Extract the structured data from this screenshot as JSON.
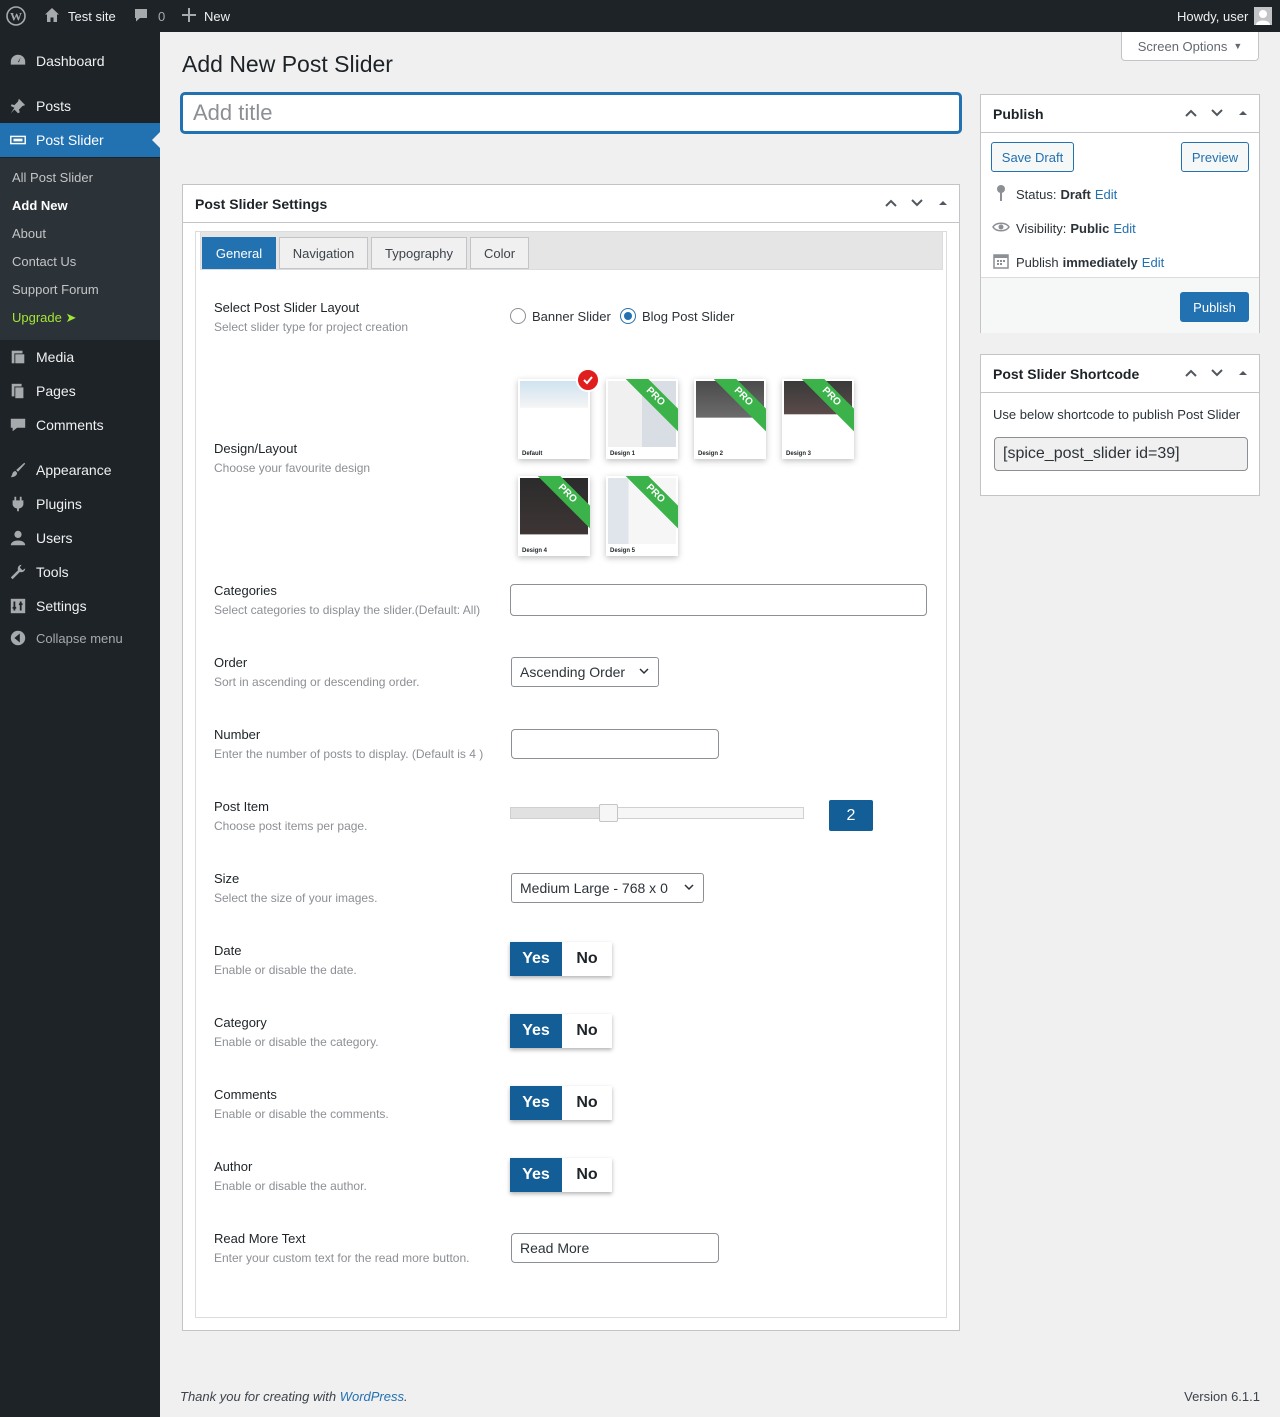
{
  "adminbar": {
    "site_name": "Test site",
    "comments_count": "0",
    "new_label": "New",
    "howdy": "Howdy, user"
  },
  "sidebar": {
    "items": [
      {
        "label": "Dashboard",
        "icon": "dashboard-icon"
      },
      {
        "label": "Posts",
        "icon": "pin-icon"
      },
      {
        "label": "Post Slider",
        "icon": "slider-icon"
      },
      {
        "label": "Media",
        "icon": "media-icon"
      },
      {
        "label": "Pages",
        "icon": "pages-icon"
      },
      {
        "label": "Comments",
        "icon": "comments-icon"
      },
      {
        "label": "Appearance",
        "icon": "brush-icon"
      },
      {
        "label": "Plugins",
        "icon": "plugin-icon"
      },
      {
        "label": "Users",
        "icon": "user-icon"
      },
      {
        "label": "Tools",
        "icon": "wrench-icon"
      },
      {
        "label": "Settings",
        "icon": "settings-icon"
      },
      {
        "label": "Collapse menu",
        "icon": "collapse-icon"
      }
    ],
    "submenu": [
      "All Post Slider",
      "Add New",
      "About",
      "Contact Us",
      "Support Forum",
      "Upgrade"
    ],
    "upgrade_color": "#a3e635"
  },
  "page": {
    "title": "Add New Post Slider",
    "screen_options": "Screen Options",
    "title_placeholder": "Add title"
  },
  "settings": {
    "heading": "Post Slider Settings",
    "tabs": [
      "General",
      "Navigation",
      "Typography",
      "Color"
    ],
    "fields": {
      "layout": {
        "label": "Select Post Slider Layout",
        "desc": "Select slider type for project creation",
        "options": [
          "Banner Slider",
          "Blog Post Slider"
        ],
        "selected": "Blog Post Slider"
      },
      "design": {
        "label": "Design/Layout",
        "desc": "Choose your favourite design",
        "designs": [
          "Default",
          "Design 1",
          "Design 2",
          "Design 3",
          "Design 4",
          "Design 5"
        ],
        "pro_badge": "PRO",
        "selected": "Default"
      },
      "categories": {
        "label": "Categories",
        "desc": "Select categories to display the slider.(Default: All)",
        "value": ""
      },
      "order": {
        "label": "Order",
        "desc": "Sort in ascending or descending order.",
        "value": "Ascending Order"
      },
      "number": {
        "label": "Number",
        "desc": "Enter the number of posts to display. (Default is 4 )",
        "value": ""
      },
      "post_item": {
        "label": "Post Item",
        "desc": "Choose post items per page.",
        "value": "2"
      },
      "size": {
        "label": "Size",
        "desc": "Select the size of your images.",
        "value": "Medium Large - 768 x 0"
      },
      "date": {
        "label": "Date",
        "desc": "Enable or disable the date."
      },
      "category": {
        "label": "Category",
        "desc": "Enable or disable the category."
      },
      "comments": {
        "label": "Comments",
        "desc": "Enable or disable the comments."
      },
      "author": {
        "label": "Author",
        "desc": "Enable or disable the author."
      },
      "read_more": {
        "label": "Read More Text",
        "desc": "Enter your custom text for the read more button.",
        "value": "Read More"
      }
    },
    "toggle_yes": "Yes",
    "toggle_no": "No"
  },
  "publish": {
    "heading": "Publish",
    "save_draft": "Save Draft",
    "preview": "Preview",
    "status_label": "Status:",
    "status_value": "Draft",
    "visibility_label": "Visibility:",
    "visibility_value": "Public",
    "publish_label": "Publish",
    "publish_value": "immediately",
    "edit": "Edit",
    "publish_button": "Publish"
  },
  "shortcode": {
    "heading": "Post Slider Shortcode",
    "desc": "Use below shortcode to publish Post Slider",
    "value": "[spice_post_slider id=39]"
  },
  "footer": {
    "thanks_prefix": "Thank you for creating with",
    "wp_link": "WordPress",
    "thanks_suffix": ".",
    "version": "Version 6.1.1"
  },
  "colors": {
    "accent": "#2271b1",
    "toggle_on": "#135e96",
    "pro": "#3cb34a",
    "check": "#e01e1e"
  }
}
